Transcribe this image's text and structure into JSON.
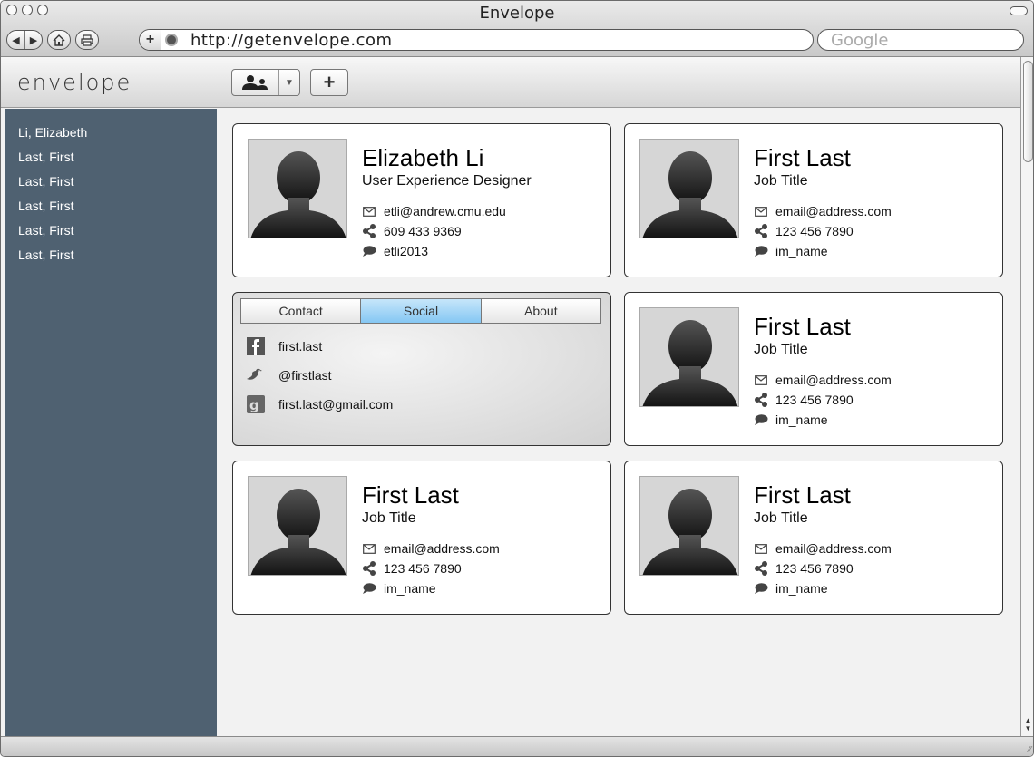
{
  "window": {
    "title": "Envelope",
    "url": "http://getenvelope.com",
    "search_placeholder": "Google"
  },
  "app": {
    "logo": "envelope",
    "add_label": "+"
  },
  "sidebar": {
    "items": [
      {
        "label": "Li, Elizabeth"
      },
      {
        "label": "Last, First"
      },
      {
        "label": "Last, First"
      },
      {
        "label": "Last, First"
      },
      {
        "label": "Last, First"
      },
      {
        "label": "Last, First"
      }
    ]
  },
  "cards": [
    {
      "name": "Elizabeth Li",
      "job": "User Experience Designer",
      "email": "etli@andrew.cmu.edu",
      "phone": "609 433 9369",
      "im": "etli2013"
    },
    {
      "name": "First Last",
      "job": "Job Title",
      "email": "email@address.com",
      "phone": "123 456 7890",
      "im": "im_name"
    },
    {
      "name": "First Last",
      "job": "Job Title",
      "email": "email@address.com",
      "phone": "123 456 7890",
      "im": "im_name"
    },
    {
      "name": "First Last",
      "job": "Job Title",
      "email": "email@address.com",
      "phone": "123 456 7890",
      "im": "im_name"
    },
    {
      "name": "First Last",
      "job": "Job Title",
      "email": "email@address.com",
      "phone": "123 456 7890",
      "im": "im_name"
    }
  ],
  "social_card": {
    "tabs": [
      {
        "label": "Contact"
      },
      {
        "label": "Social",
        "active": true
      },
      {
        "label": "About"
      }
    ],
    "rows": [
      {
        "icon": "facebook-icon",
        "text": "first.last"
      },
      {
        "icon": "twitter-bird-icon",
        "text": "@firstlast"
      },
      {
        "icon": "google-icon",
        "text": "first.last@gmail.com"
      }
    ]
  },
  "colors": {
    "sidebar_bg": "#4f6171",
    "active_tab": "#85c7f3"
  }
}
